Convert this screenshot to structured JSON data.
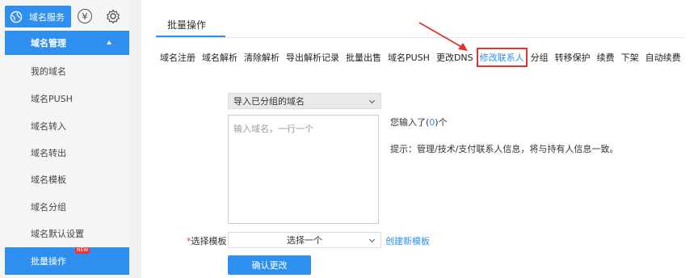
{
  "sidebar": {
    "service_label": "域名服务",
    "yen_symbol": "¥",
    "section_label": "域名管理",
    "items": [
      {
        "label": "我的域名"
      },
      {
        "label": "域名PUSH"
      },
      {
        "label": "域名转入"
      },
      {
        "label": "域名转出"
      },
      {
        "label": "域名模板"
      },
      {
        "label": "域名分组"
      },
      {
        "label": "域名默认设置"
      },
      {
        "label": "批量操作",
        "badge": "NEW"
      }
    ]
  },
  "main": {
    "tab_title": "批量操作",
    "ops": [
      "域名注册",
      "域名解析",
      "清除解析",
      "导出解析记录",
      "批量出售",
      "域名PUSH",
      "更改DNS",
      "修改联系人",
      "分组",
      "转移保护",
      "续费",
      "下架",
      "自动续费"
    ],
    "import_select": "导入已分组的域名",
    "domain_placeholder": "输入域名，一行一个",
    "input_count_prefix": "您输入了(",
    "input_count": "0",
    "input_count_suffix": ")个",
    "tip": "提示：管理/技术/支付联系人信息，将与持有人信息一致。",
    "template_required_mark": "*",
    "template_label": "选择模板",
    "template_select": "选择一个",
    "create_template_link": "创建新模板",
    "confirm_button": "确认更改"
  },
  "colors": {
    "accent": "#2f8ff0",
    "highlight_red": "#e53030"
  }
}
